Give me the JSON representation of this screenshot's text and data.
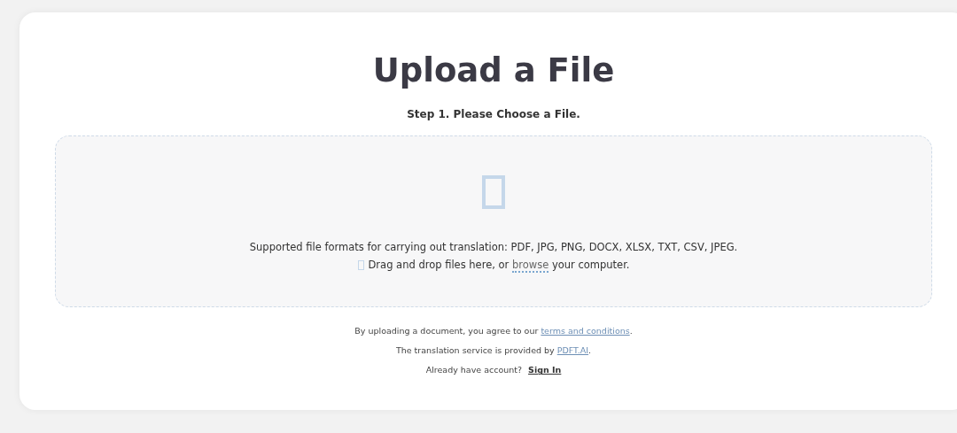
{
  "title": "Upload a File",
  "step": "Step 1. Please Choose a File.",
  "dropzone": {
    "formats": "Supported file formats for carrying out translation: PDF, JPG, PNG, DOCX, XLSX, TXT, CSV, JPEG.",
    "drag_before": "Drag and drop files here, or ",
    "browse_link": "browse",
    "drag_after": " your computer."
  },
  "legal": [
    {
      "before": "By uploading a document, you agree to our ",
      "link": "terms and conditions",
      "after": "."
    },
    {
      "before": "The translation service is provided by ",
      "link": "PDFT.AI",
      "after": "."
    }
  ],
  "account": {
    "prompt": "Already have account?",
    "sign_in": "Sign In"
  }
}
